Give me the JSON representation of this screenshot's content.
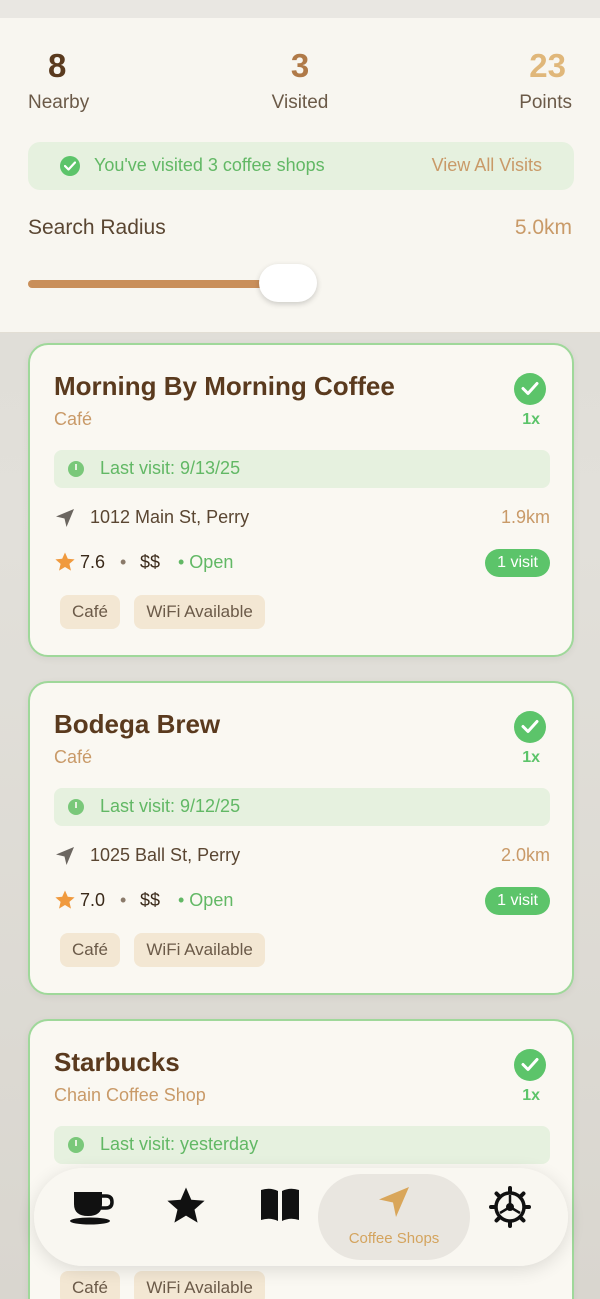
{
  "stats": {
    "nearby": {
      "value": "8",
      "label": "Nearby"
    },
    "visited": {
      "value": "3",
      "label": "Visited"
    },
    "points": {
      "value": "23",
      "label": "Points"
    }
  },
  "visited_banner": {
    "message": "You've visited 3 coffee shops",
    "link": "View All Visits"
  },
  "search_radius": {
    "label": "Search Radius",
    "value_text": "5.0km",
    "slider_fraction": 0.5
  },
  "shops": [
    {
      "name": "Morning By Morning Coffee",
      "type": "Café",
      "visit_count": "1x",
      "last_visit": "Last visit: 9/13/25",
      "address": "1012 Main St, Perry",
      "distance": "1.9km",
      "rating": "7.6",
      "price": "$$",
      "status": "• Open",
      "visits_badge": "1 visit",
      "tags": [
        "Café",
        "WiFi Available"
      ]
    },
    {
      "name": "Bodega Brew",
      "type": "Café",
      "visit_count": "1x",
      "last_visit": "Last visit: 9/12/25",
      "address": "1025 Ball St, Perry",
      "distance": "2.0km",
      "rating": "7.0",
      "price": "$$",
      "status": "• Open",
      "visits_badge": "1 visit",
      "tags": [
        "Café",
        "WiFi Available"
      ]
    },
    {
      "name": "Starbucks",
      "type": "Chain Coffee Shop",
      "visit_count": "1x",
      "last_visit": "Last visit: yesterday",
      "tags": [
        "Café",
        "WiFi Available"
      ]
    }
  ],
  "tabbar": {
    "tabs": [
      {
        "icon": "coffee-cup-icon"
      },
      {
        "icon": "star-icon"
      },
      {
        "icon": "book-icon"
      },
      {
        "icon": "location-arrow-icon",
        "label": "Coffee Shops",
        "active": true
      },
      {
        "icon": "gear-icon"
      }
    ]
  },
  "colors": {
    "accent": "#c99a68",
    "success": "#5cc46a",
    "brown": "#5a3a1e",
    "card_border": "#9fd89a"
  },
  "dot_separator": "•"
}
